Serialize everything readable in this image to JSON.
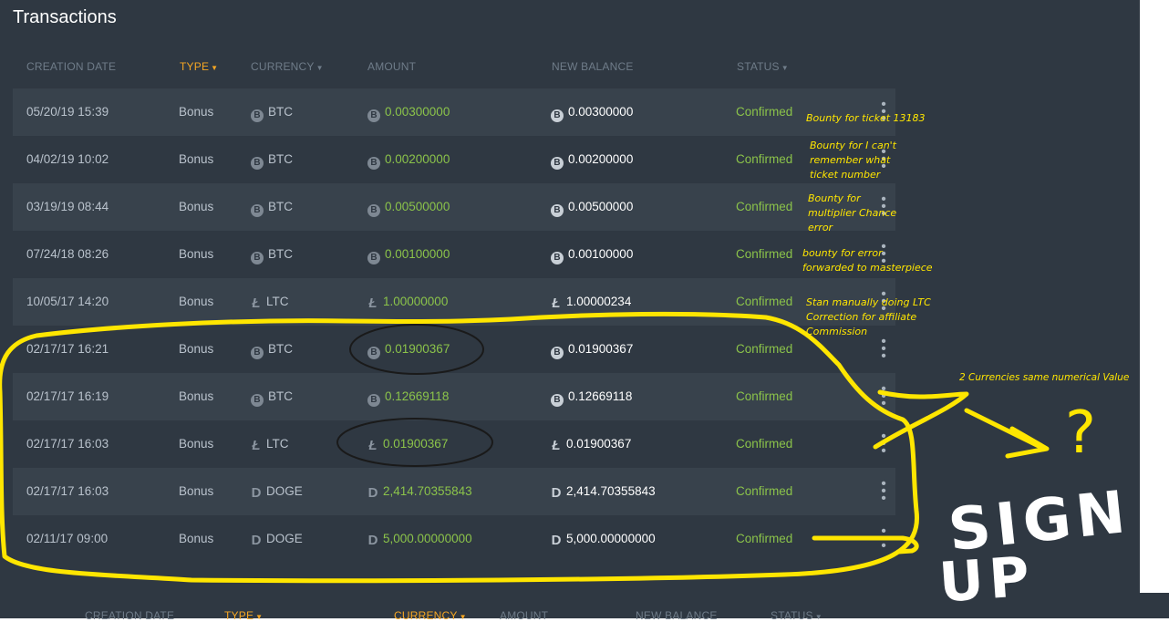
{
  "title": "Transactions",
  "headers": {
    "creation_date": "CREATION DATE",
    "type": "TYPE",
    "currency": "CURRENCY",
    "amount": "AMOUNT",
    "new_balance": "NEW BALANCE",
    "status": "STATUS"
  },
  "bottom_headers": {
    "creation_date": "CREATION DATE",
    "type": "TYPE",
    "currency": "CURRENCY",
    "amount": "AMOUNT",
    "new_balance": "NEW BALANCE",
    "status": "STATUS"
  },
  "rows": [
    {
      "date": "05/20/19 15:39",
      "type": "Bonus",
      "currency": "BTC",
      "amount": "0.00300000",
      "balance": "0.00300000",
      "status": "Confirmed"
    },
    {
      "date": "04/02/19 10:02",
      "type": "Bonus",
      "currency": "BTC",
      "amount": "0.00200000",
      "balance": "0.00200000",
      "status": "Confirmed"
    },
    {
      "date": "03/19/19 08:44",
      "type": "Bonus",
      "currency": "BTC",
      "amount": "0.00500000",
      "balance": "0.00500000",
      "status": "Confirmed"
    },
    {
      "date": "07/24/18 08:26",
      "type": "Bonus",
      "currency": "BTC",
      "amount": "0.00100000",
      "balance": "0.00100000",
      "status": "Confirmed"
    },
    {
      "date": "10/05/17 14:20",
      "type": "Bonus",
      "currency": "LTC",
      "amount": "1.00000000",
      "balance": "1.00000234",
      "status": "Confirmed"
    },
    {
      "date": "02/17/17 16:21",
      "type": "Bonus",
      "currency": "BTC",
      "amount": "0.01900367",
      "balance": "0.01900367",
      "status": "Confirmed"
    },
    {
      "date": "02/17/17 16:19",
      "type": "Bonus",
      "currency": "BTC",
      "amount": "0.12669118",
      "balance": "0.12669118",
      "status": "Confirmed"
    },
    {
      "date": "02/17/17 16:03",
      "type": "Bonus",
      "currency": "LTC",
      "amount": "0.01900367",
      "balance": "0.01900367",
      "status": "Confirmed"
    },
    {
      "date": "02/17/17 16:03",
      "type": "Bonus",
      "currency": "DOGE",
      "amount": "2,414.70355843",
      "balance": "2,414.70355843",
      "status": "Confirmed"
    },
    {
      "date": "02/11/17 09:00",
      "type": "Bonus",
      "currency": "DOGE",
      "amount": "5,000.00000000",
      "balance": "5,000.00000000",
      "status": "Confirmed"
    }
  ],
  "coin_glyphs": {
    "BTC": "B",
    "LTC": "Ł",
    "DOGE": "D"
  },
  "colors": {
    "panel_bg": "#2f3842",
    "row_alt_bg": "#38424c",
    "active_header": "#f5a623",
    "confirmed": "#8bc34a",
    "annotation": "#ffe600"
  },
  "annotations": {
    "note1": "Bounty for ticket 13183",
    "note2_line1": "Bounty for I can't",
    "note2_line2": "remember what",
    "note2_line3": "ticket number",
    "note3_line1": "Bounty for",
    "note3_line2": "multiplier Chance",
    "note3_line3": "error",
    "note4_line1": "bounty for error",
    "note4_line2": "forwarded to masterpiece",
    "note5_line1": "Stan manually doing LTC",
    "note5_line2": "Correction for affiliate",
    "note5_line3": "Commission",
    "note6": "2 Currencies same numerical Value",
    "question_mark": "?",
    "sign": "SIGN",
    "up": "UP"
  },
  "icons": {
    "menu": "kebab-menu-icon",
    "caret": "caret-down-icon"
  }
}
